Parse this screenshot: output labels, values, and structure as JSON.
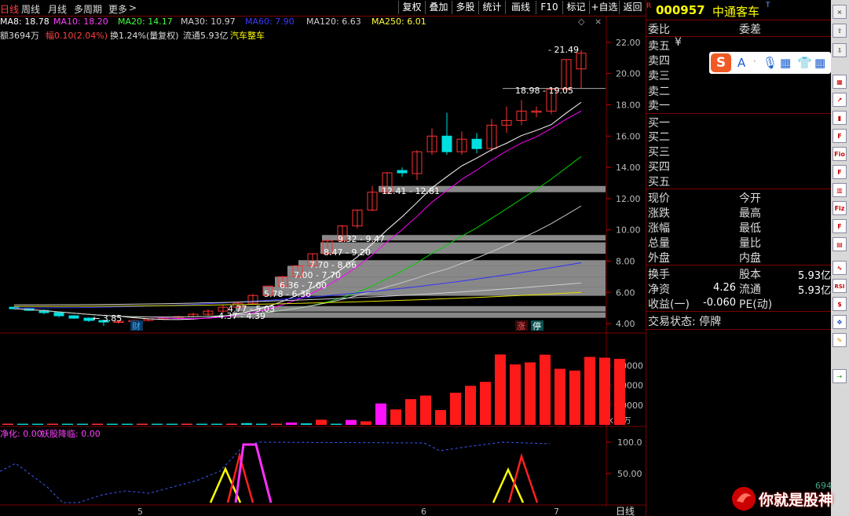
{
  "toolbar": {
    "tabs": [
      "日线",
      "周线",
      "月线",
      "多周期",
      "更多"
    ],
    "buttons": [
      "复权",
      "叠加",
      "多股",
      "统计",
      "画线",
      "F10",
      "标记",
      "+自选",
      "返回"
    ]
  },
  "ma_line": [
    {
      "label": "MA8: 18.78",
      "color": "#ffffff"
    },
    {
      "label": "MA10: 18.20",
      "color": "#ff00ff"
    },
    {
      "label": "MA20: 14.17",
      "color": "#00ff00"
    },
    {
      "label": "MA30: 10.97",
      "color": "#d0d0d0"
    },
    {
      "label": "MA60: 7.90",
      "color": "#2020ff"
    },
    {
      "label": "MA120: 6.63",
      "color": "#d0d0d0"
    },
    {
      "label": "MA250: 6.01",
      "color": "#ffff00"
    }
  ],
  "info_line": {
    "amount": "额3694万",
    "change": "幅0.10(2.04%)",
    "turnover": "换1.24%(量复权)",
    "float": "流通5.93亿",
    "sector": "汽车整车"
  },
  "price_axis": [
    "22.00",
    "20.00",
    "18.00",
    "16.00",
    "14.00",
    "12.00",
    "10.00",
    "8.00",
    "6.00",
    "4.00"
  ],
  "volume_axis": [
    "30000",
    "20000",
    "10000"
  ],
  "volume_unit": "X10万",
  "indicator_axis": [
    "100.0",
    "50.00"
  ],
  "indicator_labels": {
    "a": "净化: 0.00",
    "b": "妖股降临: 0.00"
  },
  "date_labels": [
    "5",
    "6",
    "7"
  ],
  "period_label": "日线",
  "chip_labels": [
    "12.41 - 12.81",
    "9.32 - 9.47",
    "8.47 - 9.20",
    "7.70 - 8.06",
    "7.00 - 7.70",
    "6.36 - 7.00",
    "5.78 - 6.36",
    "4.77 - 5.03",
    "4.37 - 4.39",
    "18.98 - 19.05"
  ],
  "price_notes": {
    "high": "21.49",
    "low": "3.85"
  },
  "markers": {
    "cai": "财",
    "zhang": "涨",
    "ting": "停"
  },
  "stock": {
    "code": "000957",
    "name": "中通客车",
    "flag": "R",
    "t": "T"
  },
  "quote_labels": {
    "wei_bi": "委比",
    "wei_cha": "委差",
    "sell": [
      "卖五",
      "卖四",
      "卖三",
      "卖二",
      "卖一"
    ],
    "buy": [
      "买一",
      "买二",
      "买三",
      "买四",
      "买五"
    ],
    "sell5_unit": "¥",
    "xianjia": "现价",
    "jinkai": "今开",
    "zhangdie": "涨跌",
    "zuigao": "最高",
    "zhangfu": "涨幅",
    "zuidi": "最低",
    "zongliang": "总量",
    "liangbi": "量比",
    "waipan": "外盘",
    "neipan": "内盘",
    "huanshou": "换手",
    "guben": "股本",
    "guben_val": "5.93亿",
    "jingzi": "净资",
    "jingzi_val": "4.26",
    "liutong": "流通",
    "liutong_val": "5.93亿",
    "shouyi": "收益(一)",
    "shouyi_val": "-0.060",
    "pe": "PE(动)",
    "status": "交易状态: 停牌"
  },
  "ime_label": "S",
  "watermark": {
    "text": "你就是股神",
    "num": "694"
  },
  "chart_data": {
    "type": "candlestick",
    "y_range": [
      3.6,
      22.8
    ],
    "candles": [
      {
        "o": 5.05,
        "c": 4.95,
        "h": 5.1,
        "l": 4.9
      },
      {
        "o": 4.95,
        "c": 4.85,
        "h": 5.0,
        "l": 4.8
      },
      {
        "o": 4.85,
        "c": 4.7,
        "h": 4.9,
        "l": 4.6
      },
      {
        "o": 4.7,
        "c": 4.5,
        "h": 4.75,
        "l": 4.4
      },
      {
        "o": 4.5,
        "c": 4.35,
        "h": 4.55,
        "l": 4.3
      },
      {
        "o": 4.35,
        "c": 4.2,
        "h": 4.4,
        "l": 4.1
      },
      {
        "o": 4.2,
        "c": 4.1,
        "h": 4.25,
        "l": 3.85
      },
      {
        "o": 4.1,
        "c": 4.15,
        "h": 4.2,
        "l": 4.0
      },
      {
        "o": 4.15,
        "c": 4.2,
        "h": 4.25,
        "l": 4.1
      },
      {
        "o": 4.2,
        "c": 4.3,
        "h": 4.35,
        "l": 4.15
      },
      {
        "o": 4.3,
        "c": 4.35,
        "h": 4.4,
        "l": 4.25
      },
      {
        "o": 4.35,
        "c": 4.45,
        "h": 4.5,
        "l": 4.3
      },
      {
        "o": 4.45,
        "c": 4.6,
        "h": 4.7,
        "l": 4.4
      },
      {
        "o": 4.6,
        "c": 4.8,
        "h": 4.9,
        "l": 4.5
      },
      {
        "o": 4.8,
        "c": 5.05,
        "h": 5.2,
        "l": 4.7
      },
      {
        "o": 5.05,
        "c": 5.3,
        "h": 5.4,
        "l": 5.0
      },
      {
        "o": 5.3,
        "c": 5.8,
        "h": 5.9,
        "l": 5.25
      },
      {
        "o": 5.8,
        "c": 6.4,
        "h": 6.4,
        "l": 5.75
      },
      {
        "o": 6.4,
        "c": 7.0,
        "h": 7.05,
        "l": 6.35
      },
      {
        "o": 7.0,
        "c": 7.7,
        "h": 7.7,
        "l": 6.95
      },
      {
        "o": 7.7,
        "c": 8.47,
        "h": 8.5,
        "l": 7.6
      },
      {
        "o": 8.47,
        "c": 9.32,
        "h": 9.4,
        "l": 8.4
      },
      {
        "o": 9.32,
        "c": 10.25,
        "h": 10.3,
        "l": 9.2
      },
      {
        "o": 10.25,
        "c": 11.27,
        "h": 11.3,
        "l": 10.1
      },
      {
        "o": 11.27,
        "c": 12.41,
        "h": 12.81,
        "l": 11.2
      },
      {
        "o": 12.41,
        "c": 13.65,
        "h": 13.7,
        "l": 12.3
      },
      {
        "o": 13.8,
        "c": 13.65,
        "h": 14.0,
        "l": 13.4
      },
      {
        "o": 13.6,
        "c": 15.0,
        "h": 15.1,
        "l": 13.2
      },
      {
        "o": 15.0,
        "c": 16.0,
        "h": 16.5,
        "l": 14.8
      },
      {
        "o": 16.0,
        "c": 15.0,
        "h": 17.5,
        "l": 14.8
      },
      {
        "o": 15.0,
        "c": 15.8,
        "h": 16.3,
        "l": 14.8
      },
      {
        "o": 15.8,
        "c": 15.2,
        "h": 16.2,
        "l": 14.9
      },
      {
        "o": 15.2,
        "c": 16.7,
        "h": 17.1,
        "l": 15.0
      },
      {
        "o": 16.7,
        "c": 17.0,
        "h": 17.9,
        "l": 16.2
      },
      {
        "o": 17.0,
        "c": 17.6,
        "h": 18.3,
        "l": 16.7
      },
      {
        "o": 17.6,
        "c": 17.6,
        "h": 17.9,
        "l": 17.2
      },
      {
        "o": 17.6,
        "c": 19.0,
        "h": 19.1,
        "l": 17.4
      },
      {
        "o": 19.0,
        "c": 20.9,
        "h": 20.9,
        "l": 18.9
      },
      {
        "o": 20.3,
        "c": 21.3,
        "h": 21.49,
        "l": 19.05
      }
    ],
    "volume": [
      300,
      280,
      250,
      240,
      200,
      180,
      250,
      220,
      180,
      160,
      150,
      170,
      200,
      250,
      300,
      400,
      900,
      600,
      500,
      1200,
      800,
      2600,
      600,
      2500,
      1800,
      10800,
      7800,
      13000,
      14800,
      7500,
      16200,
      19700,
      21700,
      35500,
      30500,
      31500,
      35400,
      28300,
      27400,
      34300,
      33900,
      33300
    ],
    "volume_range": [
      0,
      40000
    ]
  }
}
